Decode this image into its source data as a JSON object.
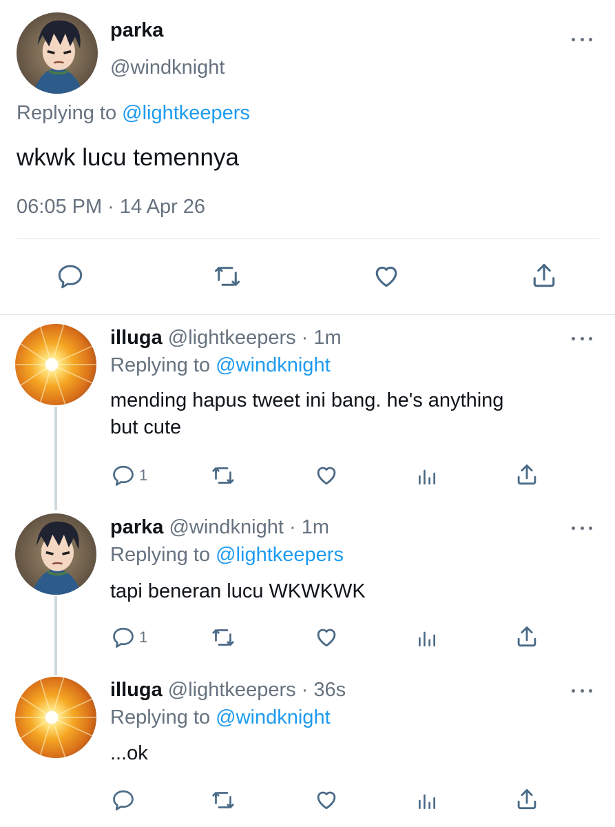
{
  "main_tweet": {
    "name": "parka",
    "handle": "@windknight",
    "replying_prefix": "Replying to",
    "replying_to": "@lightkeepers",
    "text": "wkwk lucu temennya",
    "timestamp": "06:05 PM · 14 Apr 26"
  },
  "replies": [
    {
      "name": "illuga",
      "meta": "@lightkeepers · 1m",
      "replying_prefix": "Replying to",
      "replying_to": "@windknight",
      "text_line1": "mending hapus tweet ini bang. he's anything",
      "text_line2": "but cute",
      "reply_count": "1"
    },
    {
      "name": "parka",
      "meta": "@windknight · 1m",
      "replying_prefix": "Replying to",
      "replying_to": "@lightkeepers",
      "text_line1": "tapi beneran lucu WKWKWK",
      "reply_count": "1"
    },
    {
      "name": "illuga",
      "meta": "@lightkeepers · 36s",
      "replying_prefix": "Replying to",
      "replying_to": "@windknight",
      "text_line1": "...ok"
    }
  ],
  "colors": {
    "link": "#1d9bf0",
    "secondary_text": "#66727f",
    "icon": "#4a6a86"
  },
  "icons": [
    "more-icon",
    "reply-icon",
    "retweet-icon",
    "like-icon",
    "share-icon",
    "analytics-icon"
  ]
}
